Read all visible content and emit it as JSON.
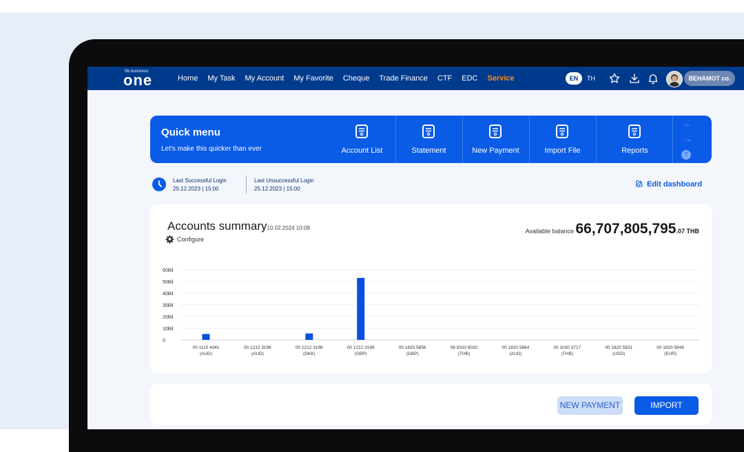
{
  "nav": {
    "logo_small": "ttb business",
    "logo_big": "one",
    "items": [
      {
        "label": "Home"
      },
      {
        "label": "My Task"
      },
      {
        "label": "My Account"
      },
      {
        "label": "My Favorite"
      },
      {
        "label": "Cheque"
      },
      {
        "label": "Trade Finance"
      },
      {
        "label": "CTF"
      },
      {
        "label": "EDC"
      },
      {
        "label": "Service"
      }
    ],
    "active_item": "Service",
    "lang_en": "EN",
    "lang_th": "TH",
    "icons": [
      "star-icon",
      "download-icon",
      "bell-icon"
    ],
    "user_name": "BEHAMOT co."
  },
  "quick_menu": {
    "title": "Quick menu",
    "subtitle": "Let's make this quicker than ever",
    "items": [
      {
        "label": "Account List",
        "icon": "document-icon"
      },
      {
        "label": "Statement",
        "icon": "document-icon"
      },
      {
        "label": "New Payment",
        "icon": "document-icon"
      },
      {
        "label": "Import File",
        "icon": "document-icon"
      },
      {
        "label": "Reports",
        "icon": "document-icon"
      }
    ],
    "arrow_prev": "←",
    "arrow_next": "→",
    "hint_icon": "?"
  },
  "login": {
    "success_label": "Last Successful Login",
    "success_time": "25.12.2023 | 15:00",
    "fail_label": "Last Unsuccessful Login",
    "fail_time": "25.12.2023 | 15:00"
  },
  "edit_dashboard": "Edit dashboard",
  "summary": {
    "title": "Accounts summary",
    "timestamp": "10.02.2024 10:08",
    "configure": "Configure",
    "available_label": "Available balance",
    "balance": "66,707,805,795",
    "balance_cents": ".07 THB"
  },
  "chart_data": {
    "type": "bar",
    "categories": [
      [
        "00 1115 4341",
        "(AUD)"
      ],
      [
        "00 1212 3196",
        "(AUD)"
      ],
      [
        "00 1212 3196",
        "(DKK)"
      ],
      [
        "00 1212 3196",
        "(GBP)"
      ],
      [
        "00 1820 5856",
        "(GBP)"
      ],
      [
        "08 9333 6032",
        "(THB)"
      ],
      [
        "00 1820 5864",
        "(AUD)"
      ],
      [
        "00 1030 3717",
        "(THB)"
      ],
      [
        "00 1820 5831",
        "(USD)"
      ],
      [
        "00 1820 5849",
        "(EUR)"
      ]
    ],
    "values": [
      5,
      0,
      5.5,
      53,
      0,
      0,
      0,
      0,
      0,
      0
    ],
    "y_ticks": [
      "0",
      "10Bil",
      "20Bil",
      "30Bil",
      "40Bil",
      "50Bil",
      "60Bil"
    ],
    "ylim": [
      0,
      60
    ],
    "grid": true,
    "bar_color": "#0a4fe0"
  },
  "actions": {
    "new_payment": "NEW PAYMENT",
    "import": "IMPORT"
  },
  "colors": {
    "nav_bg": "#003a8c",
    "accent": "#0a5be6",
    "active_menu": "#ff8c1a"
  }
}
